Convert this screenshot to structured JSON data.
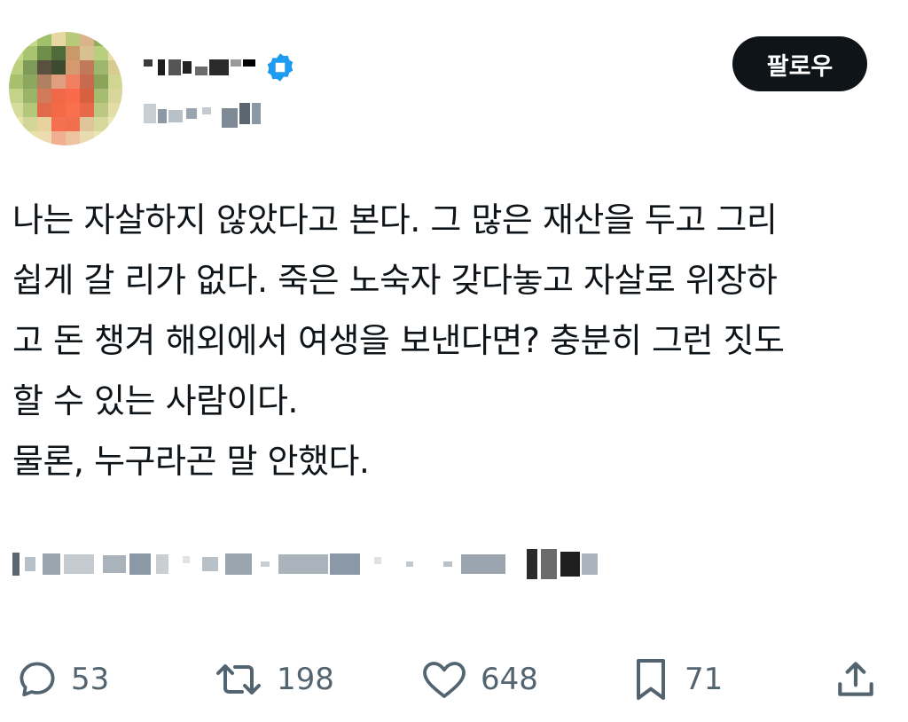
{
  "header": {
    "follow_label": "팔로우",
    "verified_color": "#1d9bf0"
  },
  "tweet": {
    "lines": [
      "나는 자살하지 않았다고 본다. 그 많은 재산을 두고 그리",
      "쉽게 갈 리가 없다. 죽은 노숙자 갖다놓고 자살로 위장하",
      "고 돈 챙겨 해외에서 여생을 보낸다면? 충분히 그런 짓도",
      "할 수 있는 사람이다.",
      "물론, 누구라곤 말 안했다."
    ]
  },
  "actions": {
    "replies": {
      "icon": "reply-icon",
      "count": "53"
    },
    "reposts": {
      "icon": "repost-icon",
      "count": "198"
    },
    "likes": {
      "icon": "heart-icon",
      "count": "648"
    },
    "bookmarks": {
      "icon": "bookmark-icon",
      "count": "71"
    },
    "share": {
      "icon": "share-icon"
    }
  },
  "colors": {
    "text": "#0f1419",
    "secondary": "#536471",
    "button_bg": "#0f1419"
  }
}
